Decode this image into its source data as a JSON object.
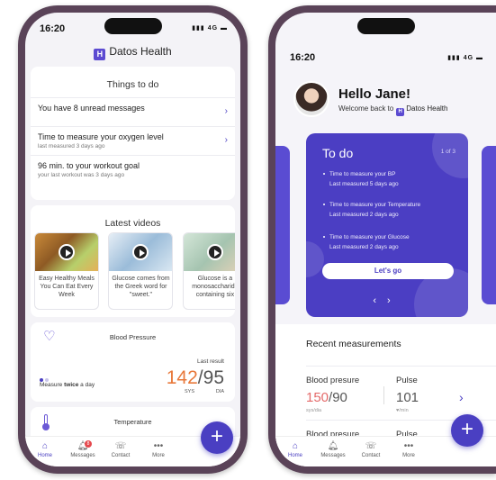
{
  "phone1": {
    "status": {
      "time": "16:20",
      "signal": "4G"
    },
    "brand": {
      "logo_letter": "H",
      "name": "Datos Health"
    },
    "todo": {
      "title": "Things to do",
      "items": [
        {
          "title": "You have 8 unread messages",
          "sub": ""
        },
        {
          "title": "Time to measure your oxygen level",
          "sub": "last measured 3 days ago"
        },
        {
          "title": "96 min. to your workout goal",
          "sub": "your last workout was 3 days ago"
        }
      ]
    },
    "videos": {
      "title": "Latest videos",
      "items": [
        {
          "caption": "Easy Healthy Meals You Can Eat Every Week"
        },
        {
          "caption": "Glucose comes from the Greek word for \"sweet.\""
        },
        {
          "caption": "Glucose is a monosaccharide containing six"
        }
      ]
    },
    "blood_pressure": {
      "title": "Blood Pressure",
      "last_result_label": "Last result",
      "sys_value": "142",
      "separator": "/",
      "dia_value": "95",
      "sys_label": "SYS",
      "dia_label": "DIA",
      "frequency_prefix": "Measure ",
      "frequency_bold": "twice",
      "frequency_suffix": " a day"
    },
    "temperature": {
      "title": "Temperature"
    },
    "tabs": [
      {
        "label": "Home"
      },
      {
        "label": "Messages",
        "badge": "8"
      },
      {
        "label": "Contact"
      },
      {
        "label": "More"
      }
    ],
    "fab_label": "+"
  },
  "phone2": {
    "status": {
      "time": "16:20",
      "signal": "4G"
    },
    "greeting": "Hello Jane!",
    "welcome": "Welcome back to",
    "brand": {
      "logo_letter": "H",
      "name": "Datos Health"
    },
    "todo": {
      "title": "To do",
      "pager": "1 of 3",
      "items": [
        {
          "line1": "Time to measure your BP",
          "line2": "Last measured 5 days ago"
        },
        {
          "line1": "Time to measure your Temperature",
          "line2": "Last measured 2 days ago"
        },
        {
          "line1": "Time to measure your Glucose",
          "line2": "Last measured 2 days ago"
        }
      ],
      "button": "Let's go",
      "prev": "‹",
      "next": "›"
    },
    "recent": {
      "title": "Recent measurements",
      "rows": [
        {
          "label1": "Blood presure",
          "label2": "Pulse",
          "sys": "150",
          "sep": "/",
          "dia": "90",
          "pulse": "101",
          "unit1": "sys/dia",
          "unit2": "♥/min"
        },
        {
          "label1": "Blood presure",
          "label2": "Pulse"
        }
      ]
    },
    "tabs": [
      {
        "label": "Home"
      },
      {
        "label": "Messages"
      },
      {
        "label": "Contact"
      },
      {
        "label": "More"
      }
    ],
    "fab_label": "+"
  },
  "colors": {
    "primary": "#4b3ec3",
    "accent_orange": "#e8783a",
    "accent_red": "#e46a6a",
    "frame": "#5a4358"
  }
}
